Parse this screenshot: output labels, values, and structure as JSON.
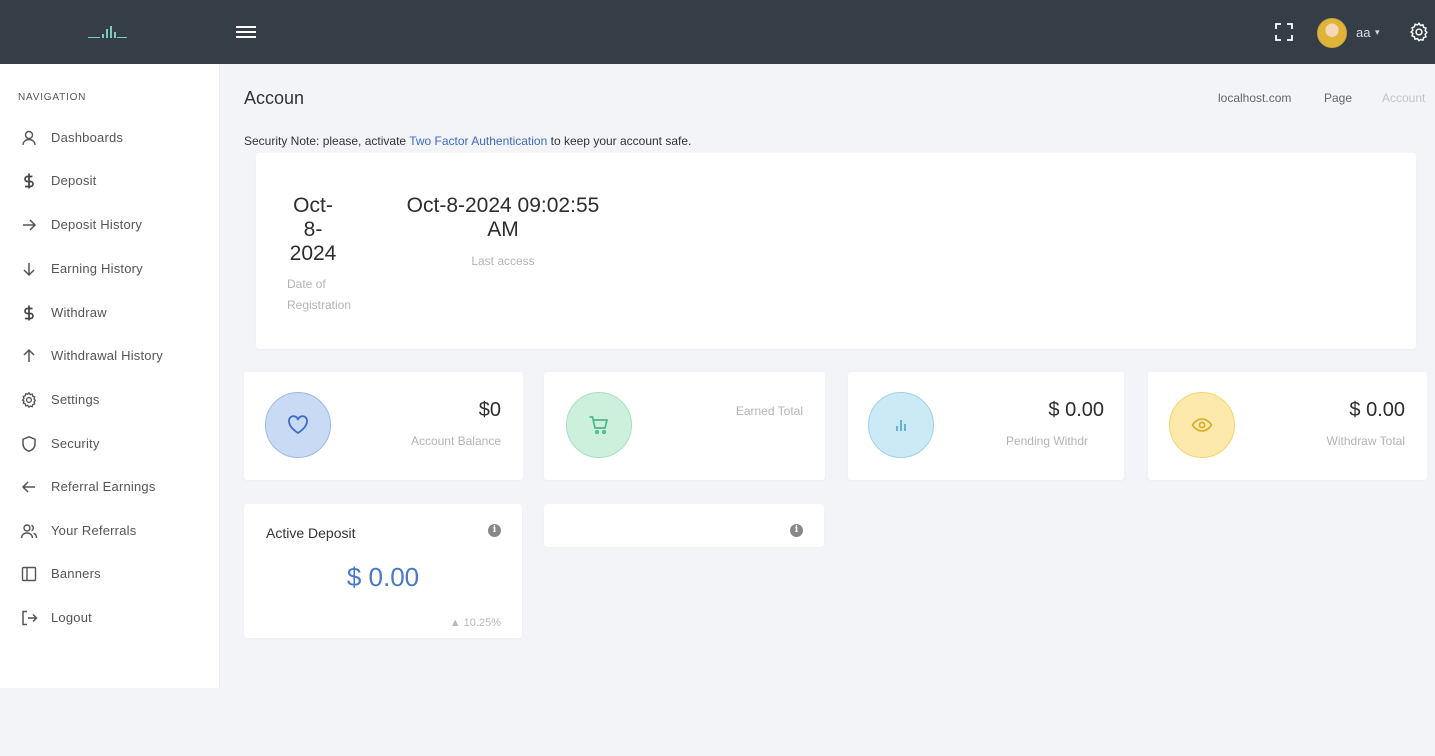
{
  "header": {
    "user_name": "aa",
    "caret": "▾"
  },
  "sidebar": {
    "heading": "NAVIGATION",
    "items": [
      {
        "label": "Dashboards",
        "icon": "user-icon"
      },
      {
        "label": "Deposit",
        "icon": "dollar-icon"
      },
      {
        "label": "Deposit History",
        "icon": "arrow-right-icon"
      },
      {
        "label": "Earning History",
        "icon": "arrow-down-icon"
      },
      {
        "label": "Withdraw",
        "icon": "dollar-icon"
      },
      {
        "label": "Withdrawal History",
        "icon": "arrow-up-icon"
      },
      {
        "label": "Settings",
        "icon": "gear-icon"
      },
      {
        "label": "Security",
        "icon": "shield-icon"
      },
      {
        "label": "Referral Earnings",
        "icon": "arrow-left-icon"
      },
      {
        "label": "Your Referrals",
        "icon": "users-icon"
      },
      {
        "label": "Banners",
        "icon": "sidebar-panel-icon"
      },
      {
        "label": "Logout",
        "icon": "logout-icon"
      }
    ]
  },
  "page": {
    "title": "Accoun",
    "breadcrumb": [
      "localhost.com",
      "Page",
      "Account"
    ]
  },
  "security_note": {
    "prefix": "Security Note: please, activate ",
    "link": "Two Factor Authentication",
    "suffix": " to keep your account safe."
  },
  "account_info": {
    "registration_date_lines": [
      "Oct-",
      "8-",
      "2024"
    ],
    "registration_label_lines": [
      "Date of",
      "Registration"
    ],
    "last_access_lines": [
      "Oct-8-2024 09:02:55",
      "AM"
    ],
    "last_access_label": "Last access"
  },
  "stats": [
    {
      "value": "$0",
      "label": "Account Balance",
      "icon": "heart-icon"
    },
    {
      "value": "",
      "label": "Earned Total",
      "icon": "cart-icon"
    },
    {
      "value": "$ 0.00",
      "label": "Pending Withdr",
      "icon": "bar-chart-icon"
    },
    {
      "value": "$ 0.00",
      "label": "Withdraw Total",
      "icon": "eye-icon"
    }
  ],
  "active_deposit": {
    "title": "Active Deposit",
    "amount": "$ 0.00",
    "change": "▲ 10.25%"
  },
  "colors": {
    "topbar": "#353e47",
    "link": "#3d6bc6",
    "accent_amount": "#4a78c9",
    "balance_circle": "#c9daf5",
    "earned_circle": "#cdf0dd",
    "pending_circle": "#cbeaf6",
    "withdraw_circle": "#fde9ac"
  }
}
